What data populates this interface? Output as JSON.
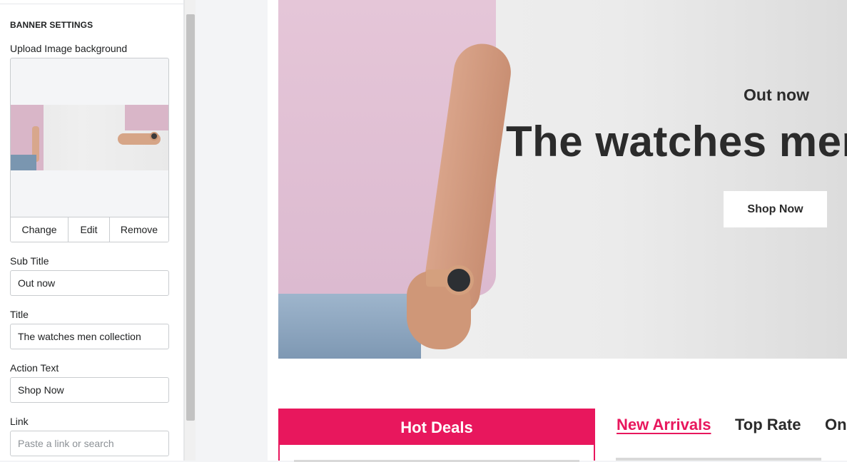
{
  "sidebar": {
    "section_heading": "BANNER SETTINGS",
    "image_label": "Upload Image background",
    "image_actions": {
      "change": "Change",
      "edit": "Edit",
      "remove": "Remove"
    },
    "subtitle_label": "Sub Title",
    "subtitle_value": "Out now",
    "title_label": "Title",
    "title_value": "The watches men collection",
    "action_label": "Action Text",
    "action_value": "Shop Now",
    "link_label": "Link",
    "link_placeholder": "Paste a link or search"
  },
  "banner": {
    "subtitle": "Out now",
    "title": "The watches men",
    "button": "Shop Now"
  },
  "products": {
    "hot_deals": "Hot Deals",
    "tabs": [
      "New Arrivals",
      "Top Rate",
      "On"
    ]
  },
  "colors": {
    "accent": "#e8175d",
    "text": "#2b2b2b"
  }
}
